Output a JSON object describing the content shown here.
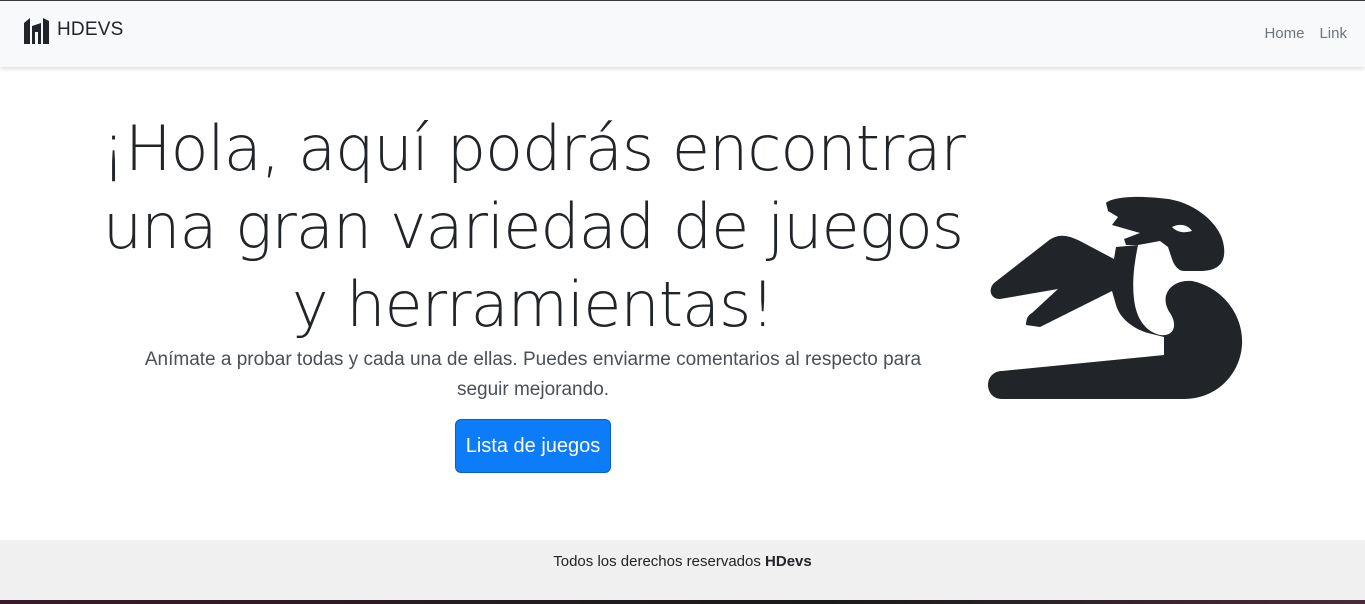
{
  "navbar": {
    "brand": "HDEVS",
    "brand_icon": "hdevs-logo-icon",
    "links": [
      {
        "label": "Home"
      },
      {
        "label": "Link"
      }
    ]
  },
  "hero": {
    "title": "¡Hola, aquí podrás encontrar una gran variedad de juegos y herramientas!",
    "lead": "Anímate a probar todas y cada una de ellas. Puedes enviarme comentarios al respecto para seguir mejorando.",
    "button_label": "Lista de juegos",
    "illustration": "dragon-icon"
  },
  "footer": {
    "text": "Todos los derechos reservados",
    "brand": "HDevs"
  },
  "colors": {
    "primary": "#0d7cf8",
    "navbar_bg": "#f8f9fa",
    "footer_bg": "#f0f0f0",
    "text": "#212529"
  }
}
